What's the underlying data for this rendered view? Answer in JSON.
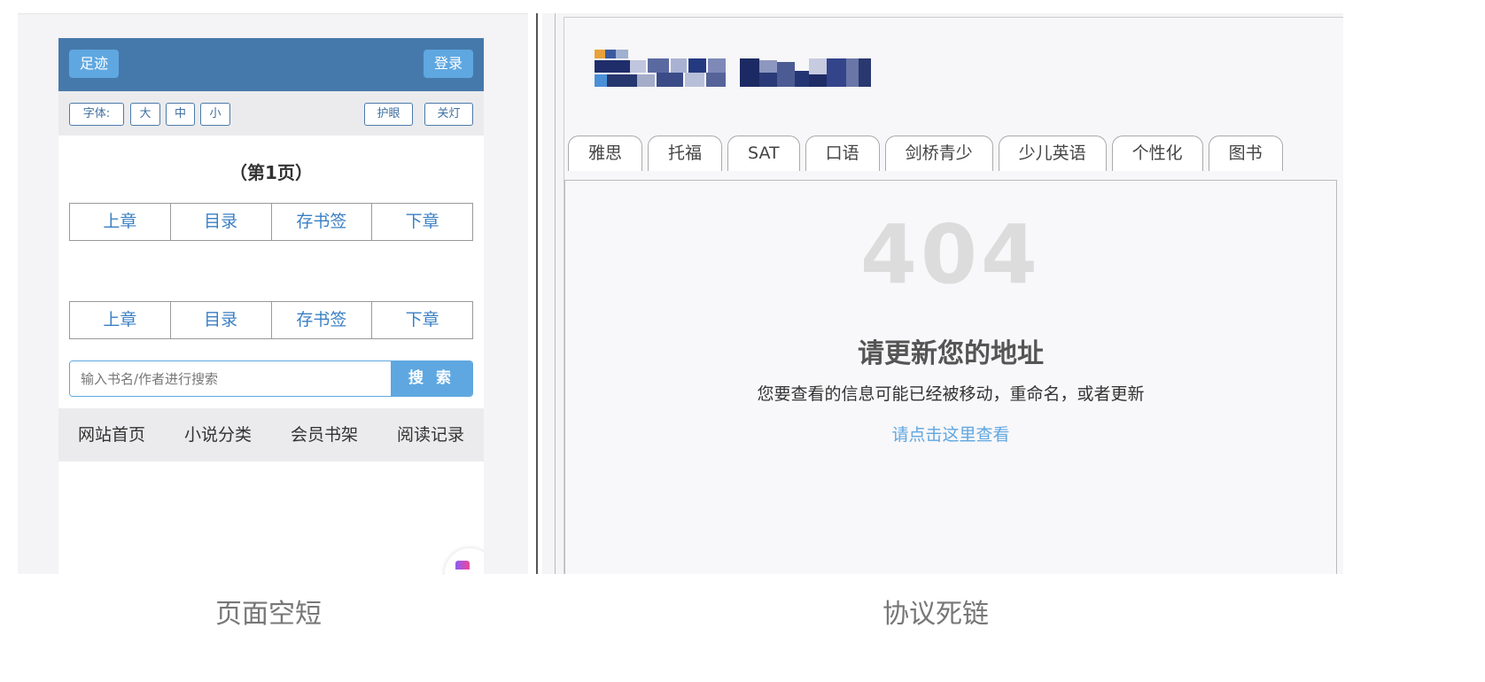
{
  "left_panel": {
    "topbar": {
      "footprint_label": "足迹",
      "login_label": "登录"
    },
    "fontbar": {
      "font_label": "字体:",
      "big": "大",
      "medium": "中",
      "small": "小",
      "eye_care": "护眼",
      "lights_off": "关灯"
    },
    "chapter_title": "（第1页）",
    "nav": [
      "上章",
      "目录",
      "存书签",
      "下章"
    ],
    "search": {
      "placeholder": "输入书名/作者进行搜索",
      "button": "搜 索"
    },
    "footer": [
      "网站首页",
      "小说分类",
      "会员书架",
      "阅读记录"
    ],
    "caption": "页面空短"
  },
  "right_panel": {
    "tabs": [
      "雅思",
      "托福",
      "SAT",
      "口语",
      "剑桥青少",
      "少儿英语",
      "个性化",
      "图书"
    ],
    "error_code": "404",
    "title": "请更新您的地址",
    "subtitle": "您要查看的信息可能已经被移动，重命名，或者更新",
    "link": "请点击这里查看",
    "caption": "协议死链"
  },
  "colors": {
    "topbar_blue": "#4679ab",
    "button_blue": "#5fa7e0",
    "link_blue": "#3a7fc4",
    "muted_404": "#dcdcdc"
  }
}
